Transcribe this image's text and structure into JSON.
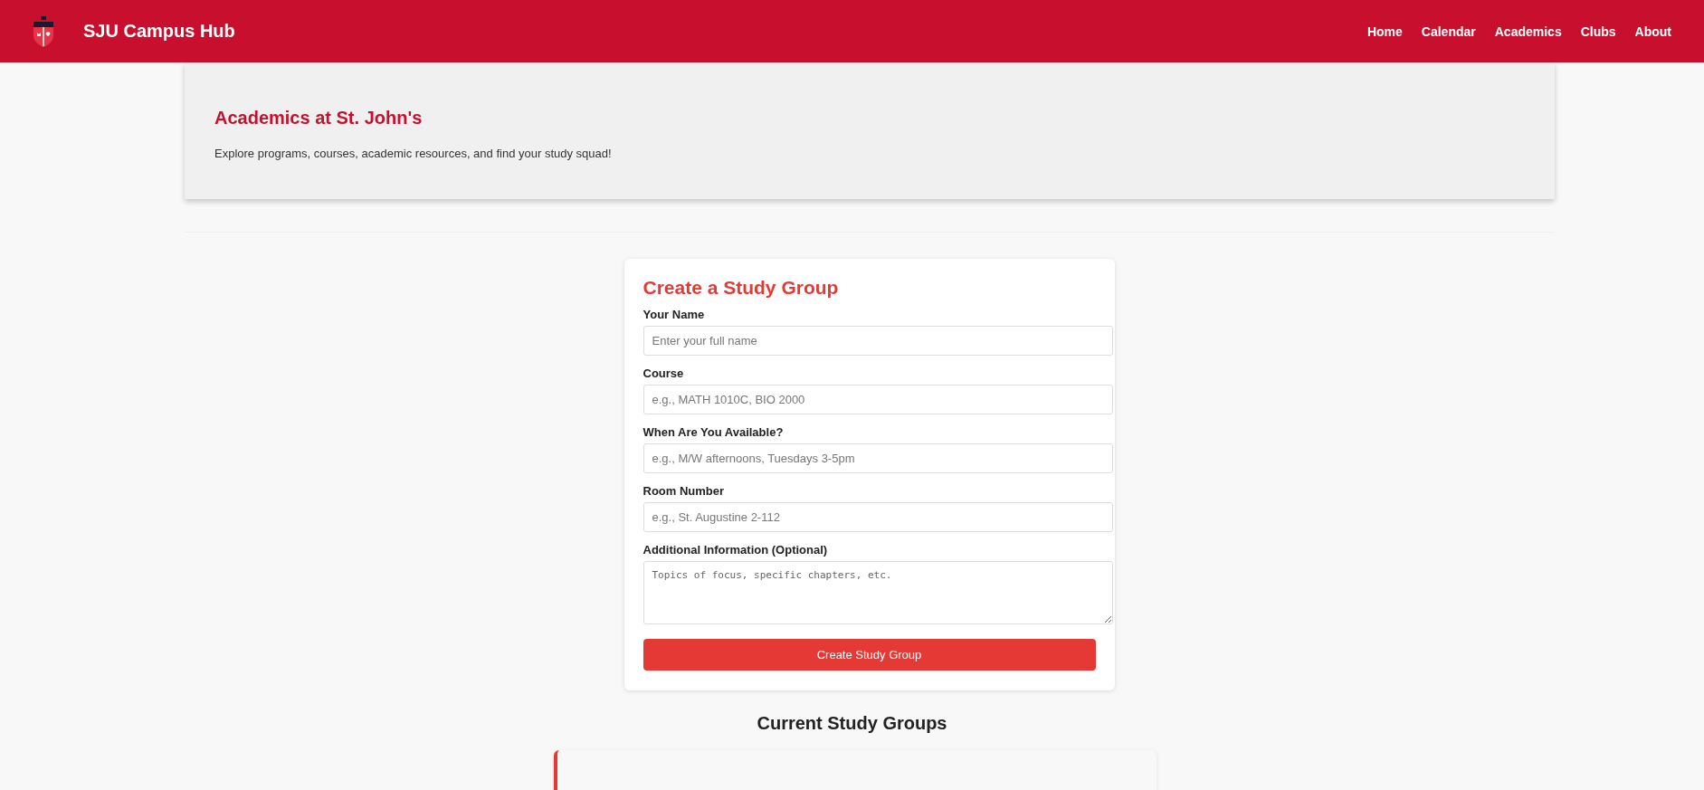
{
  "header": {
    "title": "SJU Campus Hub",
    "nav": [
      {
        "label": "Home"
      },
      {
        "label": "Calendar"
      },
      {
        "label": "Academics"
      },
      {
        "label": "Clubs"
      },
      {
        "label": "About"
      }
    ]
  },
  "hero": {
    "title": "Academics at St. John's",
    "description": "Explore programs, courses, academic resources, and find your study squad!"
  },
  "form": {
    "title": "Create a Study Group",
    "fields": [
      {
        "kind": "input",
        "label": "Your Name",
        "placeholder": "Enter your full name"
      },
      {
        "kind": "input",
        "label": "Course",
        "placeholder": "e.g., MATH 1010C, BIO 2000"
      },
      {
        "kind": "input",
        "label": "When Are You Available?",
        "placeholder": "e.g., M/W afternoons, Tuesdays 3-5pm"
      },
      {
        "kind": "input",
        "label": "Room Number",
        "placeholder": "e.g., St. Augustine 2-112"
      },
      {
        "kind": "textarea",
        "label": "Additional Information (Optional)",
        "placeholder": "Topics of focus, specific chapters, etc."
      }
    ],
    "submit": "Create Study Group"
  },
  "groups": {
    "title": "Current Study Groups",
    "cards": [
      {
        "kind": "card"
      }
    ]
  }
}
